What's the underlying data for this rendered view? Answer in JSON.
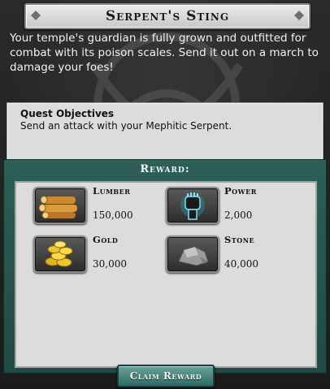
{
  "quest": {
    "title": "Serpent's Sting",
    "description": "Your temple's guardian is fully grown and outfitted for combat with its poison scales. Send it out on a march to damage your foes!"
  },
  "objectives": {
    "title": "Quest Objectives",
    "items": [
      "Send an attack with your Mephitic Serpent."
    ]
  },
  "reward": {
    "title": "Reward:",
    "items": [
      {
        "name": "Lumber",
        "amount": "150,000",
        "icon": "lumber-icon"
      },
      {
        "name": "Power",
        "amount": "2,000",
        "icon": "power-fist-icon"
      },
      {
        "name": "Gold",
        "amount": "30,000",
        "icon": "gold-coins-icon"
      },
      {
        "name": "Stone",
        "amount": "40,000",
        "icon": "stone-icon"
      }
    ]
  },
  "buttons": {
    "claim_label": "Claim Reward"
  },
  "colors": {
    "frame_teal": "#2d5e58",
    "button_teal": "#4f8a83",
    "panel_dark": "#1e1e1e"
  }
}
